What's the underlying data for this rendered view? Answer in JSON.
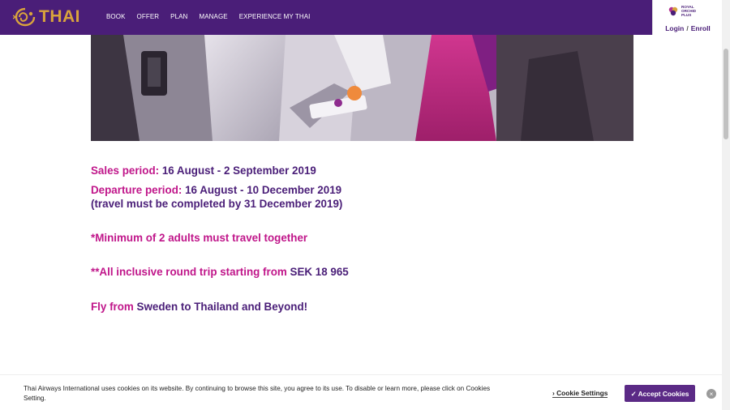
{
  "header": {
    "logo_text": "THAI",
    "nav": [
      "BOOK",
      "OFFER",
      "PLAN",
      "MANAGE",
      "EXPERIENCE MY THAI"
    ],
    "rop_logo_lines": [
      "ROYAL",
      "ORCHID",
      "PLUS"
    ],
    "login_label": "Login",
    "separator": "/",
    "enroll_label": "Enroll"
  },
  "offer": {
    "sales_label": "Sales period:",
    "sales_value": " 16 August - 2 September 2019",
    "departure_label": "Departure period:",
    "departure_value": " 16 August - 10 December 2019",
    "travel_note": "(travel must be completed by 31 December 2019)",
    "minimum_note": "*Minimum of 2 adults must travel together",
    "round_trip_label": "**All inclusive round trip starting from",
    "round_trip_price": " SEK 18 965",
    "fly_from_label": "Fly from",
    "fly_from_value": " Sweden to Thailand and Beyond!"
  },
  "cookie_bar": {
    "text": "Thai Airways International uses cookies on its website. By continuing to browse this site, you agree to its use. To disable or learn more, please click on Cookies Setting.",
    "settings_label": "Cookie Settings",
    "accept_label": "✓ Accept Cookies",
    "close_glyph": "×"
  },
  "colors": {
    "brand_purple": "#4a1e78",
    "accent_pink": "#c0168a",
    "logo_gold": "#d9a43c"
  },
  "icons": [
    "thai-logo-icon",
    "royal-orchid-plus-icon",
    "chevron-right-icon",
    "close-icon"
  ]
}
